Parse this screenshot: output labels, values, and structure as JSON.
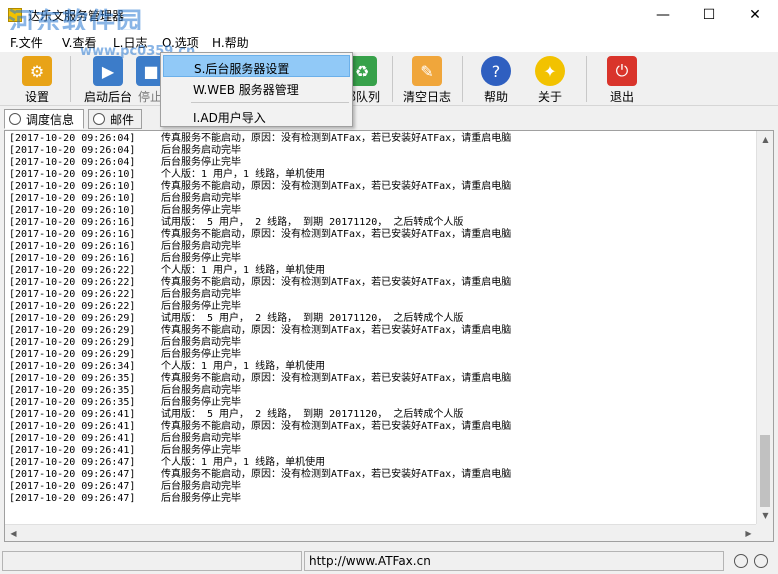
{
  "window": {
    "title": "达乐文服务管理器",
    "minimize": "—",
    "maximize": "☐",
    "close": "✕"
  },
  "watermark": {
    "brand": "河东软件园",
    "url": "www.pc0359.cn"
  },
  "menu": [
    {
      "label": "F.文件"
    },
    {
      "label": "V.查看"
    },
    {
      "label": "L.日志"
    },
    {
      "label": "O.选项"
    },
    {
      "label": "H.帮助"
    }
  ],
  "toolbar": [
    {
      "label": "设置",
      "icon": "gear-icon",
      "color": "#e8a317"
    },
    {
      "label": "启动后台",
      "icon": "start-service-icon",
      "color": "#3c7cc9"
    },
    {
      "label": "停止",
      "icon": "stop-service-icon",
      "color": "#3c7cc9"
    },
    {
      "label": "部队列",
      "icon": "recycle-bin-icon",
      "color": "#37a14a"
    },
    {
      "label": "清空日志",
      "icon": "clear-log-icon",
      "color": "#f0a63b"
    },
    {
      "label": "帮助",
      "icon": "help-icon",
      "color": "#2f5fc0"
    },
    {
      "label": "关于",
      "icon": "lightbulb-icon",
      "color": "#f2c200"
    },
    {
      "label": "退出",
      "icon": "power-icon",
      "color": "#d9342b"
    }
  ],
  "dropdown": [
    {
      "label": "S.后台服务器设置"
    },
    {
      "label": "W.WEB 服务器管理"
    },
    {
      "label": "I.AD用户导入"
    }
  ],
  "tabs": [
    {
      "label": "调度信息"
    },
    {
      "label": "邮件"
    }
  ],
  "log": [
    [
      "[2017-10-20 09:26:04]",
      "传真服务不能启动，原因：没有检测到ATFax，若已安装好ATFax，请重启电脑"
    ],
    [
      "[2017-10-20 09:26:04]",
      "后台服务启动完毕"
    ],
    [
      "[2017-10-20 09:26:04]",
      "后台服务停止完毕"
    ],
    [
      "[2017-10-20 09:26:10]",
      "个人版：1 用户，1 线路，单机使用"
    ],
    [
      "[2017-10-20 09:26:10]",
      "传真服务不能启动，原因：没有检测到ATFax，若已安装好ATFax，请重启电脑"
    ],
    [
      "[2017-10-20 09:26:10]",
      "后台服务启动完毕"
    ],
    [
      "[2017-10-20 09:26:10]",
      "后台服务停止完毕"
    ],
    [
      "[2017-10-20 09:26:16]",
      "试用版： 5 用户， 2 线路， 到期 20171120， 之后转成个人版"
    ],
    [
      "[2017-10-20 09:26:16]",
      "传真服务不能启动，原因：没有检测到ATFax，若已安装好ATFax，请重启电脑"
    ],
    [
      "[2017-10-20 09:26:16]",
      "后台服务启动完毕"
    ],
    [
      "[2017-10-20 09:26:16]",
      "后台服务停止完毕"
    ],
    [
      "[2017-10-20 09:26:22]",
      "个人版：1 用户，1 线路，单机使用"
    ],
    [
      "[2017-10-20 09:26:22]",
      "传真服务不能启动，原因：没有检测到ATFax，若已安装好ATFax，请重启电脑"
    ],
    [
      "[2017-10-20 09:26:22]",
      "后台服务启动完毕"
    ],
    [
      "[2017-10-20 09:26:22]",
      "后台服务停止完毕"
    ],
    [
      "[2017-10-20 09:26:29]",
      "试用版： 5 用户， 2 线路， 到期 20171120， 之后转成个人版"
    ],
    [
      "[2017-10-20 09:26:29]",
      "传真服务不能启动，原因：没有检测到ATFax，若已安装好ATFax，请重启电脑"
    ],
    [
      "[2017-10-20 09:26:29]",
      "后台服务启动完毕"
    ],
    [
      "[2017-10-20 09:26:29]",
      "后台服务停止完毕"
    ],
    [
      "[2017-10-20 09:26:34]",
      "个人版：1 用户，1 线路，单机使用"
    ],
    [
      "[2017-10-20 09:26:35]",
      "传真服务不能启动，原因：没有检测到ATFax，若已安装好ATFax，请重启电脑"
    ],
    [
      "[2017-10-20 09:26:35]",
      "后台服务启动完毕"
    ],
    [
      "[2017-10-20 09:26:35]",
      "后台服务停止完毕"
    ],
    [
      "[2017-10-20 09:26:41]",
      "试用版： 5 用户， 2 线路， 到期 20171120， 之后转成个人版"
    ],
    [
      "[2017-10-20 09:26:41]",
      "传真服务不能启动，原因：没有检测到ATFax，若已安装好ATFax，请重启电脑"
    ],
    [
      "[2017-10-20 09:26:41]",
      "后台服务启动完毕"
    ],
    [
      "[2017-10-20 09:26:41]",
      "后台服务停止完毕"
    ],
    [
      "[2017-10-20 09:26:47]",
      "个人版：1 用户，1 线路，单机使用"
    ],
    [
      "[2017-10-20 09:26:47]",
      "传真服务不能启动，原因：没有检测到ATFax，若已安装好ATFax，请重启电脑"
    ],
    [
      "[2017-10-20 09:26:47]",
      "后台服务启动完毕"
    ],
    [
      "[2017-10-20 09:26:47]",
      "后台服务停止完毕"
    ]
  ],
  "status": {
    "url": "http://www.ATFax.cn"
  }
}
